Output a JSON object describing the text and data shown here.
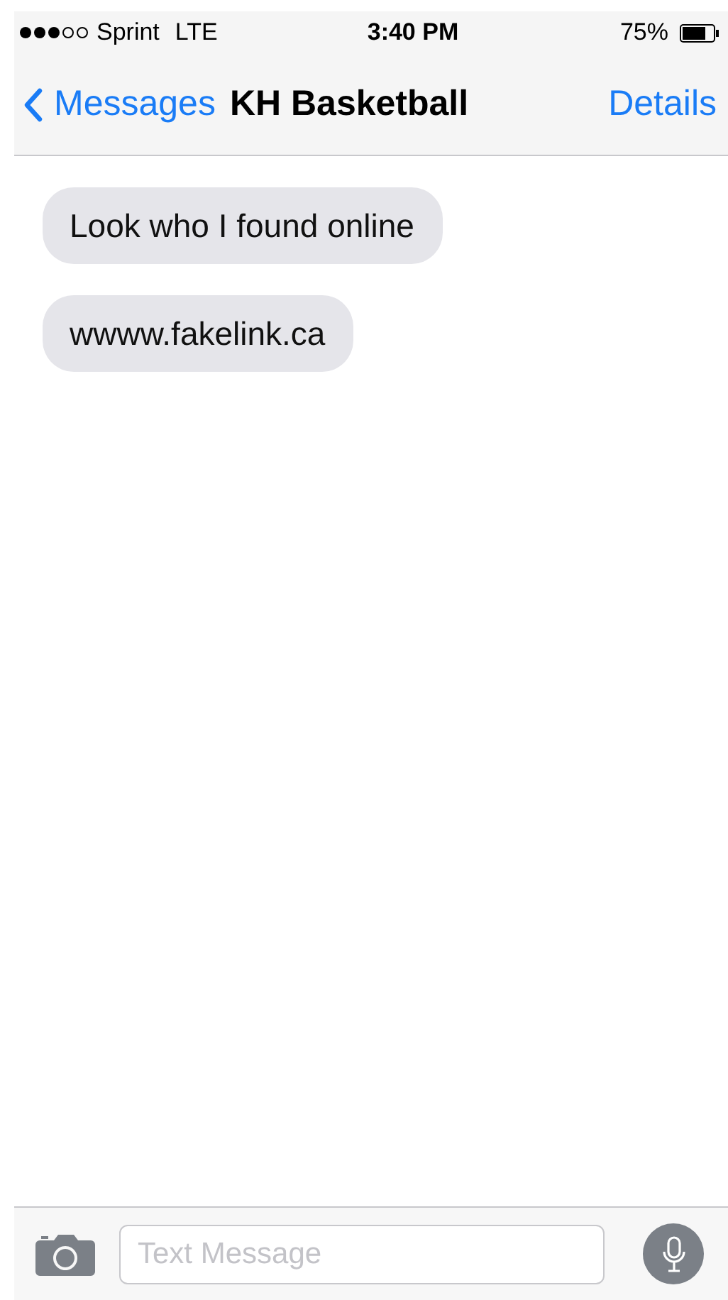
{
  "status_bar": {
    "carrier": "Sprint",
    "network": "LTE",
    "time": "3:40 PM",
    "battery": "75%"
  },
  "nav_bar": {
    "back": "Messages",
    "title": "KH Basketball",
    "action": "Details"
  },
  "messages": [
    {
      "text": "Look who I found online"
    },
    {
      "text": "wwww.fakelink.ca"
    }
  ],
  "compose": {
    "placeholder": "Text Message"
  }
}
